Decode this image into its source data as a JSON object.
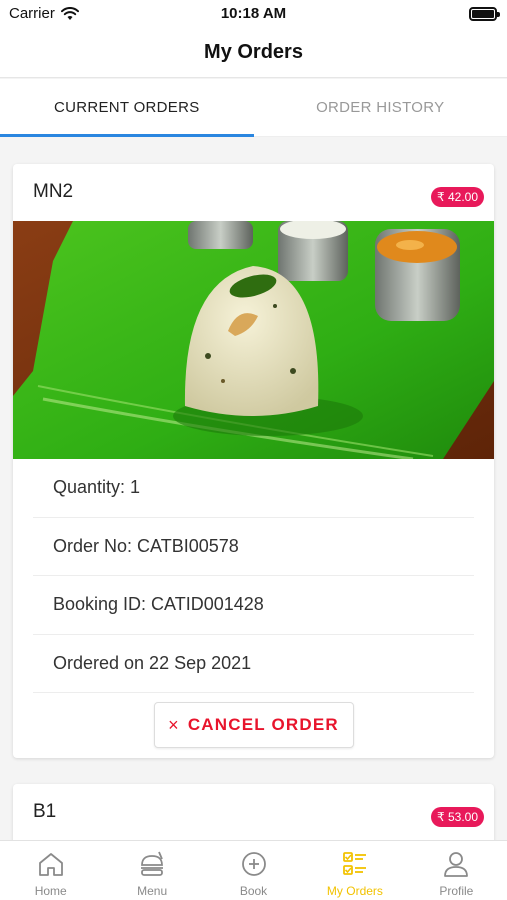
{
  "status_bar": {
    "carrier": "Carrier",
    "time": "10:18 AM"
  },
  "header": {
    "title": "My Orders"
  },
  "tabs": [
    {
      "label": "CURRENT ORDERS",
      "active": true
    },
    {
      "label": "ORDER HISTORY",
      "active": false
    }
  ],
  "orders": [
    {
      "code": "MN2",
      "price": "₹ 42.00",
      "quantity": "Quantity: 1",
      "order_no": "Order No: CATBI00578",
      "booking_id": "Booking ID: CATID001428",
      "ordered_on": "Ordered on 22 Sep 2021",
      "cancel_label": "CANCEL ORDER",
      "cancel_icon": "×"
    },
    {
      "code": "B1",
      "price": "₹ 53.00"
    }
  ],
  "tab_bar": {
    "items": [
      {
        "label": "Home",
        "icon": "home-icon"
      },
      {
        "label": "Menu",
        "icon": "menu-icon"
      },
      {
        "label": "Book",
        "icon": "book-icon"
      },
      {
        "label": "My Orders",
        "icon": "my-orders-icon",
        "active": true
      },
      {
        "label": "Profile",
        "icon": "profile-icon"
      }
    ]
  },
  "colors": {
    "accent_blue": "#2a86e0",
    "price_badge": "#e8195a",
    "cancel_red": "#e8142c",
    "active_tab_yellow": "#f2c200"
  }
}
